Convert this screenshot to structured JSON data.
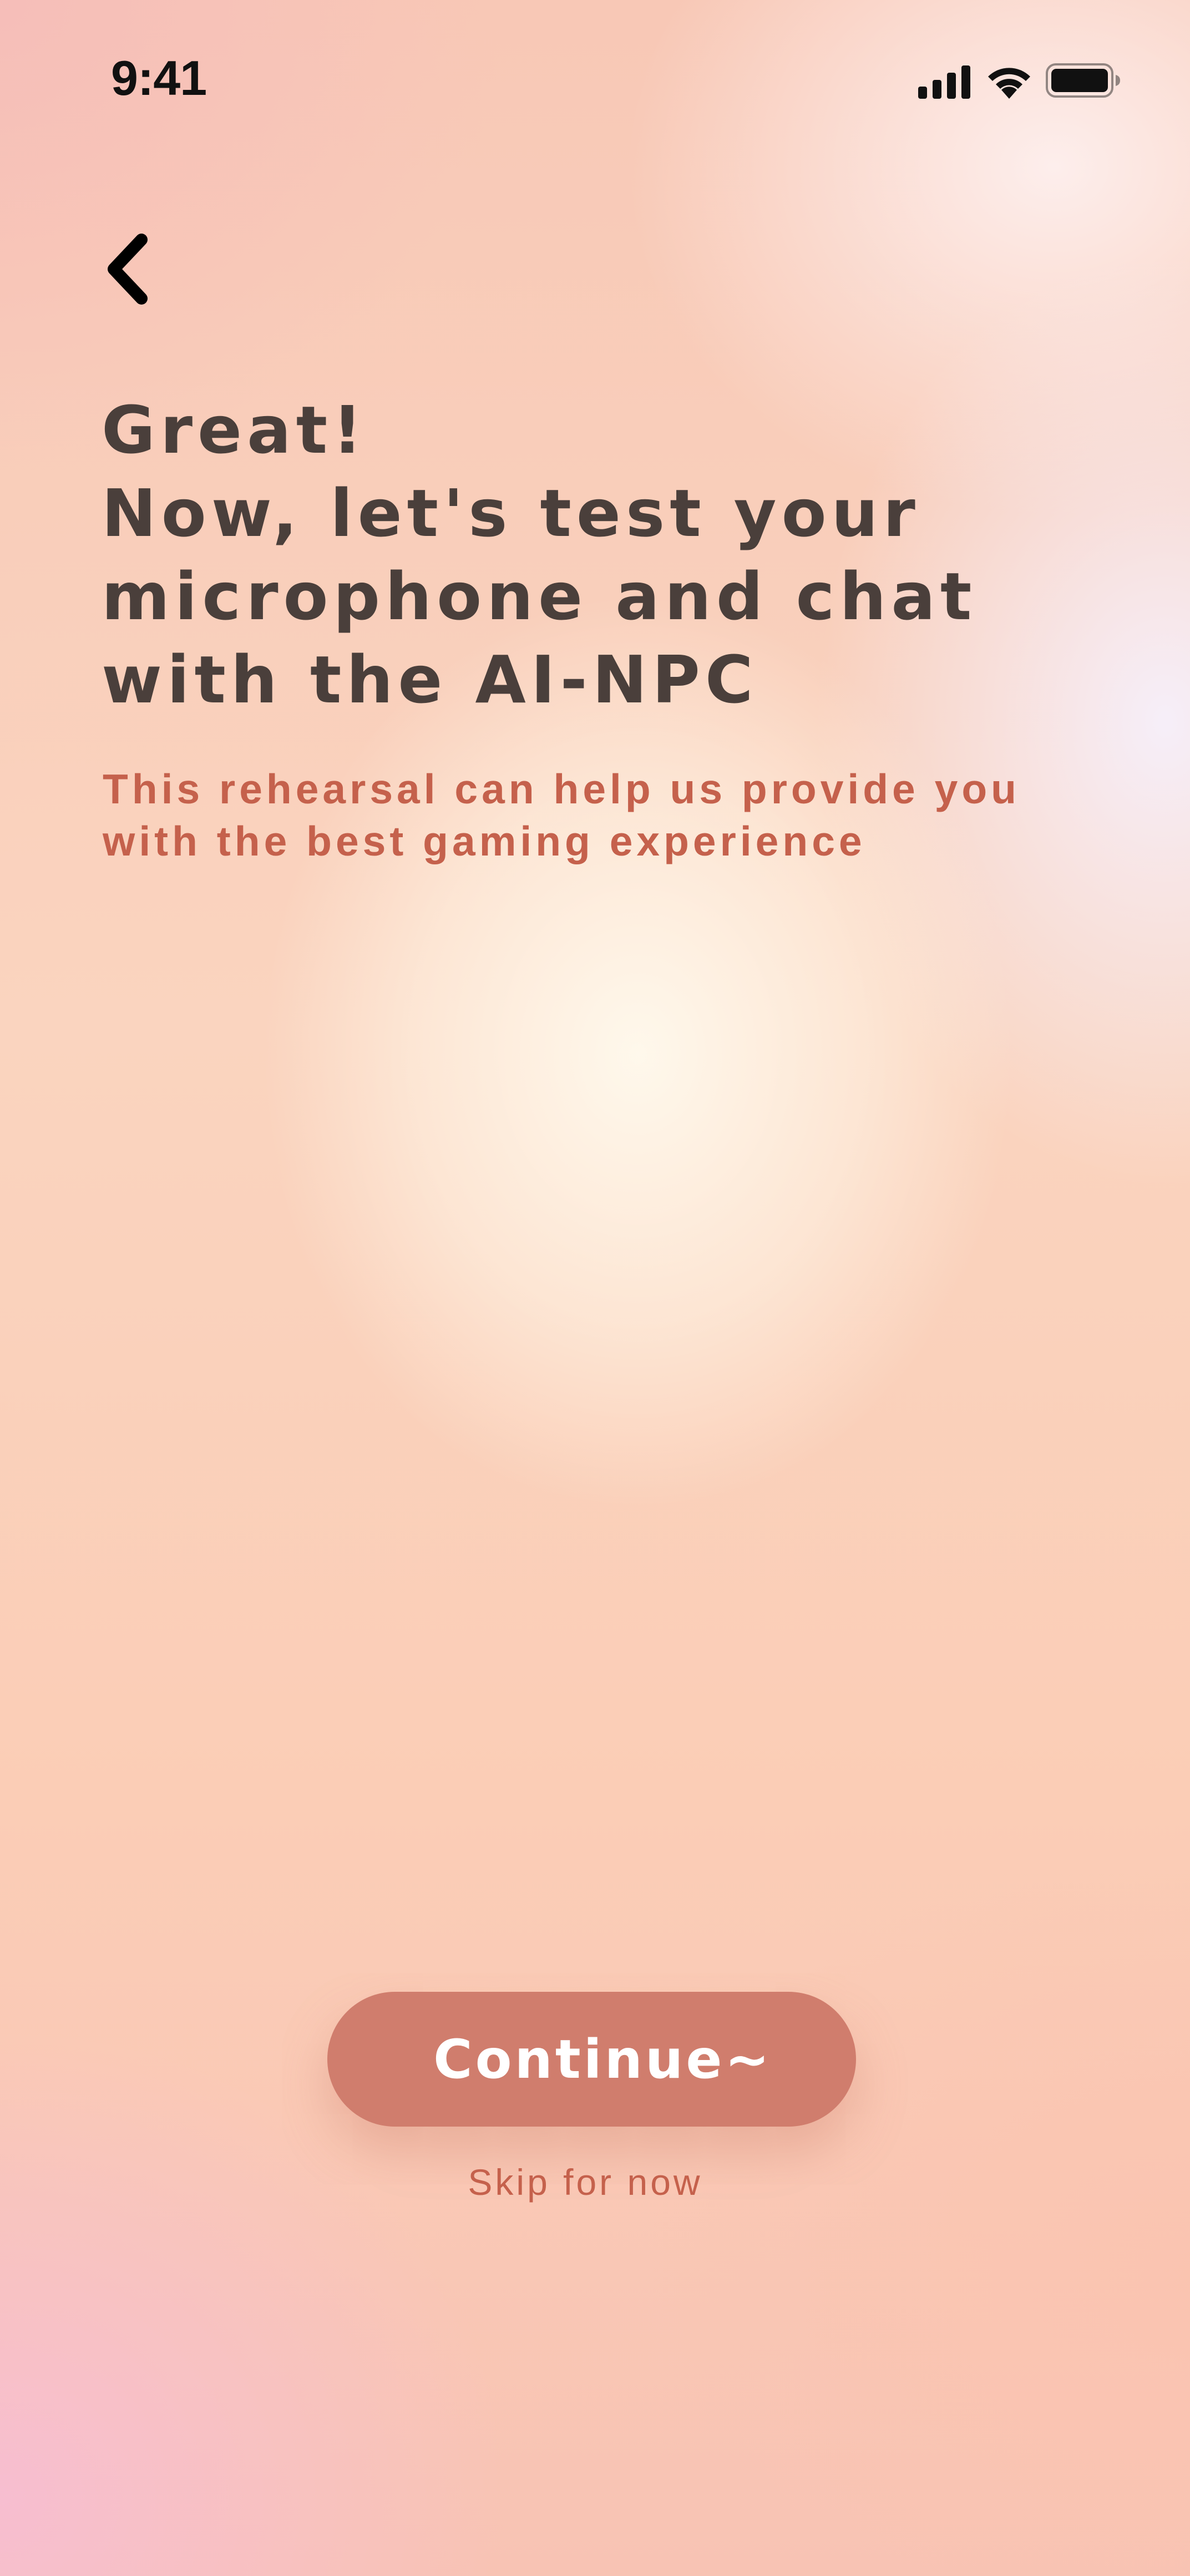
{
  "status_bar": {
    "time": "9:41",
    "icons": [
      "signal-icon",
      "wifi-icon",
      "battery-icon"
    ]
  },
  "nav": {
    "back_icon": "chevron-left-icon"
  },
  "headline": {
    "line1": "Great!",
    "line2": "Now, let's test your",
    "line3": "microphone and chat",
    "line4": "with the AI-NPC"
  },
  "subtitle": {
    "line1": "This rehearsal can help us provide you",
    "line2": "with the best gaming experience"
  },
  "actions": {
    "continue_label": "Continue~",
    "skip_label": "Skip for now"
  },
  "colors": {
    "heading": "#4a3f3b",
    "accent_text": "#c5614c",
    "button": "#d07d6d"
  }
}
